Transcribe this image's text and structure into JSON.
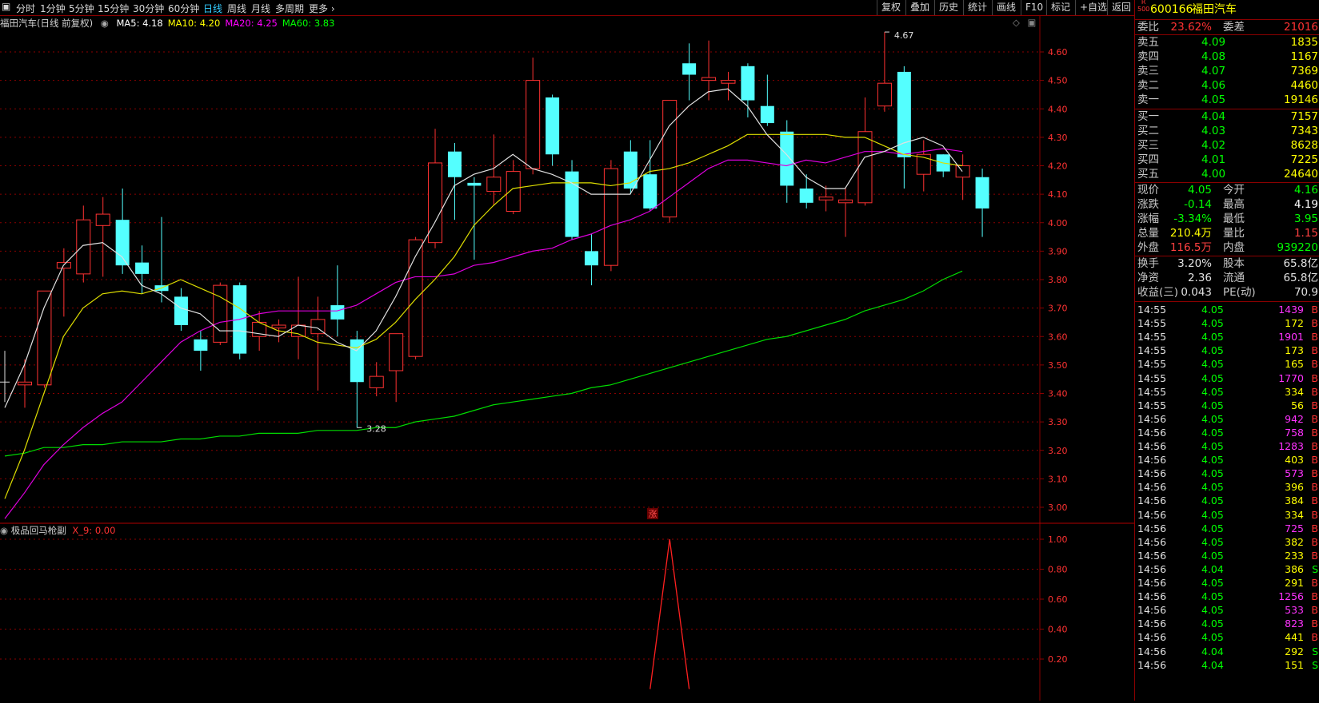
{
  "toolbar": {
    "left_items": [
      "分时",
      "1分钟",
      "5分钟",
      "15分钟",
      "30分钟",
      "60分钟",
      "日线",
      "周线",
      "月线",
      "多周期",
      "更多"
    ],
    "active": "日线",
    "right_buttons": [
      "复权",
      "叠加",
      "历史",
      "统计",
      "画线",
      "F10",
      "标记",
      "+自选",
      "返回"
    ]
  },
  "main_chart": {
    "title": "福田汽车(日线 前复权)",
    "ma_labels": [
      {
        "text": "MA5: 4.18",
        "color": "#ffffff"
      },
      {
        "text": "MA10: 4.20",
        "color": "#ffff00"
      },
      {
        "text": "MA20: 4.25",
        "color": "#ff00ff"
      },
      {
        "text": "MA60: 3.83",
        "color": "#00ff00"
      }
    ],
    "annotation_high": "4.67",
    "annotation_low": "3.28",
    "marker": "涨"
  },
  "indicator": {
    "title": "极品回马枪副",
    "value_label": "X_9: 0.00"
  },
  "chart_data": [
    {
      "type": "candlestick",
      "y_axis_labels": [
        "4.60",
        "4.50",
        "4.40",
        "4.30",
        "4.20",
        "4.10",
        "4.00",
        "3.90",
        "3.80",
        "3.70",
        "3.60",
        "3.50",
        "3.40",
        "3.30",
        "3.20",
        "3.10",
        "3.00"
      ],
      "ylim": [
        2.94,
        4.68
      ],
      "candles": [
        {
          "o": 3.43,
          "h": 3.52,
          "l": 3.35,
          "c": 3.44
        },
        {
          "o": 3.43,
          "h": 3.76,
          "l": 3.42,
          "c": 3.76
        },
        {
          "o": 3.84,
          "h": 3.91,
          "l": 3.67,
          "c": 3.86
        },
        {
          "o": 3.82,
          "h": 4.06,
          "l": 3.79,
          "c": 4.01
        },
        {
          "o": 3.99,
          "h": 4.09,
          "l": 3.81,
          "c": 4.03
        },
        {
          "o": 4.01,
          "h": 4.12,
          "l": 3.82,
          "c": 3.85
        },
        {
          "o": 3.86,
          "h": 3.92,
          "l": 3.75,
          "c": 3.82
        },
        {
          "o": 3.78,
          "h": 4.02,
          "l": 3.72,
          "c": 3.76
        },
        {
          "o": 3.74,
          "h": 3.77,
          "l": 3.62,
          "c": 3.64
        },
        {
          "o": 3.59,
          "h": 3.62,
          "l": 3.48,
          "c": 3.55
        },
        {
          "o": 3.58,
          "h": 3.79,
          "l": 3.57,
          "c": 3.78
        },
        {
          "o": 3.78,
          "h": 3.79,
          "l": 3.52,
          "c": 3.54
        },
        {
          "o": 3.6,
          "h": 3.69,
          "l": 3.55,
          "c": 3.65
        },
        {
          "o": 3.63,
          "h": 3.66,
          "l": 3.58,
          "c": 3.64
        },
        {
          "o": 3.6,
          "h": 3.81,
          "l": 3.52,
          "c": 3.64
        },
        {
          "o": 3.61,
          "h": 3.74,
          "l": 3.41,
          "c": 3.66
        },
        {
          "o": 3.71,
          "h": 3.85,
          "l": 3.6,
          "c": 3.66
        },
        {
          "o": 3.59,
          "h": 3.62,
          "l": 3.28,
          "c": 3.44
        },
        {
          "o": 3.42,
          "h": 3.51,
          "l": 3.39,
          "c": 3.46
        },
        {
          "o": 3.48,
          "h": 3.61,
          "l": 3.37,
          "c": 3.61
        },
        {
          "o": 3.53,
          "h": 3.95,
          "l": 3.52,
          "c": 3.94
        },
        {
          "o": 3.93,
          "h": 4.33,
          "l": 3.91,
          "c": 4.21
        },
        {
          "o": 4.25,
          "h": 4.28,
          "l": 4.01,
          "c": 4.16
        },
        {
          "o": 4.14,
          "h": 4.16,
          "l": 3.87,
          "c": 4.13
        },
        {
          "o": 4.11,
          "h": 4.31,
          "l": 4.06,
          "c": 4.16
        },
        {
          "o": 4.04,
          "h": 4.22,
          "l": 4.03,
          "c": 4.18
        },
        {
          "o": 4.19,
          "h": 4.58,
          "l": 4.17,
          "c": 4.5
        },
        {
          "o": 4.44,
          "h": 4.45,
          "l": 4.2,
          "c": 4.24
        },
        {
          "o": 4.18,
          "h": 4.22,
          "l": 3.94,
          "c": 3.95
        },
        {
          "o": 3.9,
          "h": 3.96,
          "l": 3.78,
          "c": 3.85
        },
        {
          "o": 3.85,
          "h": 4.22,
          "l": 3.83,
          "c": 4.19
        },
        {
          "o": 4.25,
          "h": 4.29,
          "l": 4.1,
          "c": 4.12
        },
        {
          "o": 4.17,
          "h": 4.29,
          "l": 4.04,
          "c": 4.05
        },
        {
          "o": 4.02,
          "h": 4.24,
          "l": 4.0,
          "c": 4.43
        },
        {
          "o": 4.56,
          "h": 4.63,
          "l": 4.43,
          "c": 4.52
        },
        {
          "o": 4.5,
          "h": 4.64,
          "l": 4.43,
          "c": 4.51
        },
        {
          "o": 4.49,
          "h": 4.53,
          "l": 4.43,
          "c": 4.5
        },
        {
          "o": 4.55,
          "h": 4.56,
          "l": 4.37,
          "c": 4.43
        },
        {
          "o": 4.41,
          "h": 4.52,
          "l": 4.34,
          "c": 4.35
        },
        {
          "o": 4.32,
          "h": 4.36,
          "l": 4.07,
          "c": 4.13
        },
        {
          "o": 4.12,
          "h": 4.17,
          "l": 4.05,
          "c": 4.07
        },
        {
          "o": 4.08,
          "h": 4.13,
          "l": 4.04,
          "c": 4.09
        },
        {
          "o": 4.07,
          "h": 4.12,
          "l": 3.95,
          "c": 4.08
        },
        {
          "o": 4.07,
          "h": 4.44,
          "l": 4.06,
          "c": 4.32
        },
        {
          "o": 4.41,
          "h": 4.67,
          "l": 4.39,
          "c": 4.49
        },
        {
          "o": 4.53,
          "h": 4.55,
          "l": 4.12,
          "c": 4.23
        },
        {
          "o": 4.17,
          "h": 4.29,
          "l": 4.11,
          "c": 4.24
        },
        {
          "o": 4.24,
          "h": 4.24,
          "l": 4.16,
          "c": 4.18
        },
        {
          "o": 4.16,
          "h": 4.24,
          "l": 4.08,
          "c": 4.2
        },
        {
          "o": 4.16,
          "h": 4.19,
          "l": 3.95,
          "c": 4.05
        }
      ],
      "ma5": [
        3.35,
        3.5,
        3.7,
        3.85,
        3.92,
        3.93,
        3.88,
        3.78,
        3.75,
        3.7,
        3.68,
        3.62,
        3.62,
        3.61,
        3.6,
        3.64,
        3.63,
        3.58,
        3.55,
        3.62,
        3.74,
        3.88,
        4.0,
        4.13,
        4.17,
        4.19,
        4.24,
        4.19,
        4.17,
        4.14,
        4.1,
        4.1,
        4.1,
        4.22,
        4.34,
        4.41,
        4.46,
        4.47,
        4.41,
        4.31,
        4.24,
        4.16,
        4.12,
        4.12,
        4.23,
        4.25,
        4.28,
        4.3,
        4.27,
        4.18
      ],
      "ma10": [
        3.03,
        3.2,
        3.4,
        3.6,
        3.7,
        3.75,
        3.76,
        3.75,
        3.77,
        3.8,
        3.77,
        3.74,
        3.7,
        3.65,
        3.62,
        3.61,
        3.58,
        3.57,
        3.56,
        3.59,
        3.65,
        3.73,
        3.8,
        3.88,
        3.99,
        4.06,
        4.12,
        4.13,
        4.14,
        4.14,
        4.14,
        4.13,
        4.14,
        4.18,
        4.19,
        4.21,
        4.24,
        4.27,
        4.31,
        4.31,
        4.31,
        4.31,
        4.31,
        4.3,
        4.3,
        4.27,
        4.24,
        4.23,
        4.21,
        4.2
      ],
      "ma20": [
        2.96,
        3.05,
        3.15,
        3.22,
        3.28,
        3.33,
        3.37,
        3.44,
        3.51,
        3.58,
        3.62,
        3.65,
        3.66,
        3.68,
        3.69,
        3.69,
        3.69,
        3.69,
        3.71,
        3.75,
        3.79,
        3.81,
        3.81,
        3.82,
        3.85,
        3.86,
        3.88,
        3.9,
        3.91,
        3.94,
        3.96,
        3.99,
        4.01,
        4.04,
        4.09,
        4.14,
        4.19,
        4.22,
        4.22,
        4.21,
        4.2,
        4.22,
        4.21,
        4.23,
        4.25,
        4.25,
        4.24,
        4.25,
        4.26,
        4.25
      ],
      "ma60": [
        3.18,
        3.19,
        3.21,
        3.21,
        3.22,
        3.22,
        3.23,
        3.23,
        3.23,
        3.24,
        3.24,
        3.25,
        3.25,
        3.26,
        3.26,
        3.26,
        3.27,
        3.27,
        3.27,
        3.28,
        3.28,
        3.3,
        3.31,
        3.32,
        3.34,
        3.36,
        3.37,
        3.38,
        3.39,
        3.4,
        3.42,
        3.43,
        3.45,
        3.47,
        3.49,
        3.51,
        3.53,
        3.55,
        3.57,
        3.59,
        3.6,
        3.62,
        3.64,
        3.66,
        3.69,
        3.71,
        3.73,
        3.76,
        3.8,
        3.83
      ]
    },
    {
      "type": "line",
      "y_axis_labels": [
        "1.00",
        "0.80",
        "0.60",
        "0.40",
        "0.20"
      ],
      "ylim": [
        0,
        1.1
      ],
      "series": [
        {
          "values_index": [
            32,
            33,
            34
          ],
          "values": [
            0,
            1,
            0
          ]
        }
      ]
    }
  ],
  "panel": {
    "code": "600166",
    "name": "福田汽车",
    "badge_top": "R",
    "badge_bottom": "500",
    "weibi_label": "委比",
    "weibi_value": "23.62%",
    "weicha_label": "委差",
    "weicha_value": "21016",
    "asks": [
      {
        "label": "卖五",
        "price": "4.09",
        "vol": "1835"
      },
      {
        "label": "卖四",
        "price": "4.08",
        "vol": "1167"
      },
      {
        "label": "卖三",
        "price": "4.07",
        "vol": "7369"
      },
      {
        "label": "卖二",
        "price": "4.06",
        "vol": "4460"
      },
      {
        "label": "卖一",
        "price": "4.05",
        "vol": "19146"
      }
    ],
    "bids": [
      {
        "label": "买一",
        "price": "4.04",
        "vol": "7157"
      },
      {
        "label": "买二",
        "price": "4.03",
        "vol": "7343"
      },
      {
        "label": "买三",
        "price": "4.02",
        "vol": "8628"
      },
      {
        "label": "买四",
        "price": "4.01",
        "vol": "7225"
      },
      {
        "label": "买五",
        "price": "4.00",
        "vol": "24640"
      }
    ],
    "quote": [
      {
        "l1": "现价",
        "v1": "4.05",
        "c1": "#00ff00",
        "l2": "今开",
        "v2": "4.16",
        "c2": "#00ff00"
      },
      {
        "l1": "涨跌",
        "v1": "-0.14",
        "c1": "#00ff00",
        "l2": "最高",
        "v2": "4.19",
        "c2": "#ffffff"
      },
      {
        "l1": "涨幅",
        "v1": "-3.34%",
        "c1": "#00ff00",
        "l2": "最低",
        "v2": "3.95",
        "c2": "#00ff00"
      },
      {
        "l1": "总量",
        "v1": "210.4万",
        "c1": "#ffff00",
        "l2": "量比",
        "v2": "1.15",
        "c2": "#ff4040"
      },
      {
        "l1": "外盘",
        "v1": "116.5万",
        "c1": "#ff4040",
        "l2": "内盘",
        "v2": "939220",
        "c2": "#00ff00"
      }
    ],
    "fund": [
      {
        "l1": "换手",
        "v1": "3.20%",
        "l2": "股本",
        "v2": "65.8亿"
      },
      {
        "l1": "净资",
        "v1": "2.36",
        "l2": "流通",
        "v2": "65.8亿"
      },
      {
        "l1": "收益(三)",
        "v1": "0.043",
        "l2": "PE(动)",
        "v2": "70.9"
      }
    ],
    "trades": [
      {
        "t": "14:55",
        "p": "4.05",
        "v": "1439",
        "s": "B",
        "vc": "#ff33ff"
      },
      {
        "t": "14:55",
        "p": "4.05",
        "v": "172",
        "s": "B",
        "vc": "#ffff00"
      },
      {
        "t": "14:55",
        "p": "4.05",
        "v": "1901",
        "s": "B",
        "vc": "#ff33ff"
      },
      {
        "t": "14:55",
        "p": "4.05",
        "v": "173",
        "s": "B",
        "vc": "#ffff00"
      },
      {
        "t": "14:55",
        "p": "4.05",
        "v": "165",
        "s": "B",
        "vc": "#ffff00"
      },
      {
        "t": "14:55",
        "p": "4.05",
        "v": "1770",
        "s": "B",
        "vc": "#ff33ff"
      },
      {
        "t": "14:55",
        "p": "4.05",
        "v": "334",
        "s": "B",
        "vc": "#ffff00"
      },
      {
        "t": "14:55",
        "p": "4.05",
        "v": "56",
        "s": "B",
        "vc": "#ffff00"
      },
      {
        "t": "14:56",
        "p": "4.05",
        "v": "942",
        "s": "B",
        "vc": "#ff33ff"
      },
      {
        "t": "14:56",
        "p": "4.05",
        "v": "758",
        "s": "B",
        "vc": "#ff33ff"
      },
      {
        "t": "14:56",
        "p": "4.05",
        "v": "1283",
        "s": "B",
        "vc": "#ff33ff"
      },
      {
        "t": "14:56",
        "p": "4.05",
        "v": "403",
        "s": "B",
        "vc": "#ffff00"
      },
      {
        "t": "14:56",
        "p": "4.05",
        "v": "573",
        "s": "B",
        "vc": "#ff33ff"
      },
      {
        "t": "14:56",
        "p": "4.05",
        "v": "396",
        "s": "B",
        "vc": "#ffff00"
      },
      {
        "t": "14:56",
        "p": "4.05",
        "v": "384",
        "s": "B",
        "vc": "#ffff00"
      },
      {
        "t": "14:56",
        "p": "4.05",
        "v": "334",
        "s": "B",
        "vc": "#ffff00"
      },
      {
        "t": "14:56",
        "p": "4.05",
        "v": "725",
        "s": "B",
        "vc": "#ff33ff"
      },
      {
        "t": "14:56",
        "p": "4.05",
        "v": "382",
        "s": "B",
        "vc": "#ffff00"
      },
      {
        "t": "14:56",
        "p": "4.05",
        "v": "233",
        "s": "B",
        "vc": "#ffff00"
      },
      {
        "t": "14:56",
        "p": "4.04",
        "v": "386",
        "s": "S",
        "vc": "#ffff00"
      },
      {
        "t": "14:56",
        "p": "4.05",
        "v": "291",
        "s": "B",
        "vc": "#ffff00"
      },
      {
        "t": "14:56",
        "p": "4.05",
        "v": "1256",
        "s": "B",
        "vc": "#ff33ff"
      },
      {
        "t": "14:56",
        "p": "4.05",
        "v": "533",
        "s": "B",
        "vc": "#ff33ff"
      },
      {
        "t": "14:56",
        "p": "4.05",
        "v": "823",
        "s": "B",
        "vc": "#ff33ff"
      },
      {
        "t": "14:56",
        "p": "4.05",
        "v": "441",
        "s": "B",
        "vc": "#ffff00"
      },
      {
        "t": "14:56",
        "p": "4.04",
        "v": "292",
        "s": "S",
        "vc": "#ffff00"
      },
      {
        "t": "14:56",
        "p": "4.04",
        "v": "151",
        "s": "S",
        "vc": "#ffff00"
      }
    ]
  },
  "colors": {
    "up": "#ff3232",
    "down": "#54ffff",
    "grid": "#8b0000",
    "axis_text": "#ff3232"
  }
}
